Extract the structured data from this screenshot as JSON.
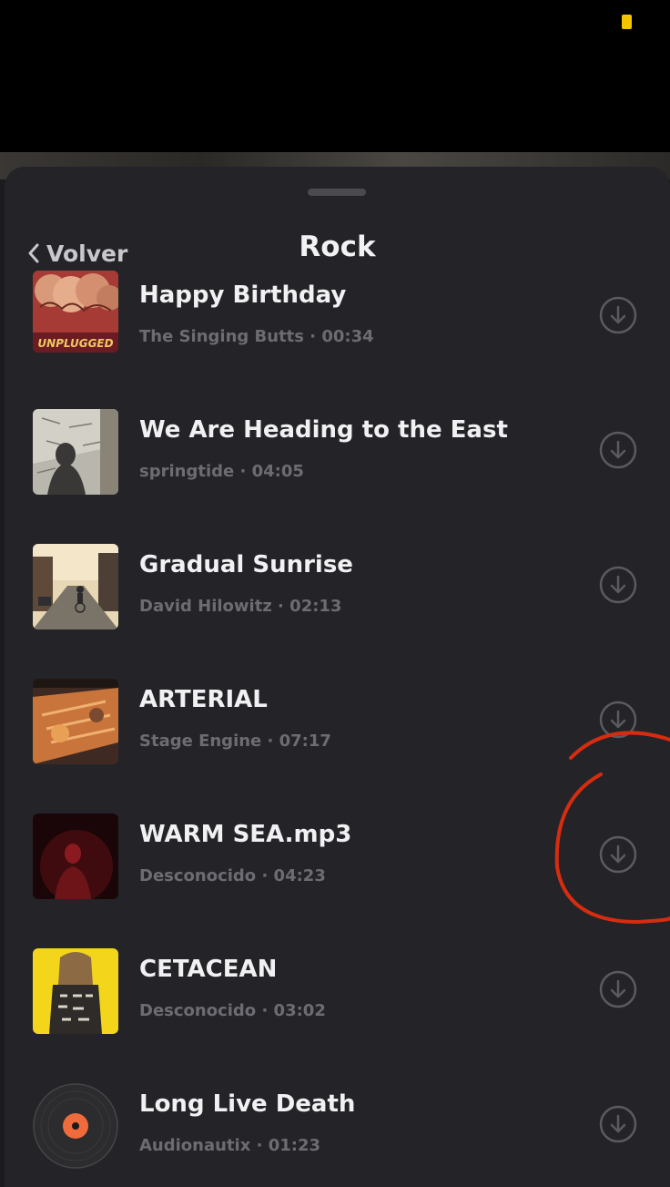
{
  "header": {
    "back_label": "Volver",
    "title": "Rock"
  },
  "songs": [
    {
      "title": "Happy Birthday",
      "subtitle": "The Singing Butts · 00:34",
      "cover": "unplugged-album",
      "cover_text": "UNPLUGGED"
    },
    {
      "title": "We Are Heading to the East",
      "subtitle": "springtide · 04:05",
      "cover": "wall-shadow-photo"
    },
    {
      "title": "Gradual Sunrise",
      "subtitle": "David Hilowitz · 02:13",
      "cover": "street-cyclist-photo"
    },
    {
      "title": "ARTERIAL",
      "subtitle": "Stage Engine · 07:17",
      "cover": "orange-abstract-art"
    },
    {
      "title": "WARM SEA.mp3",
      "subtitle": "Desconocido · 04:23",
      "cover": "red-figure-photo"
    },
    {
      "title": "CETACEAN",
      "subtitle": "Desconocido · 03:02",
      "cover": "yellow-jacket-photo"
    },
    {
      "title": "Long Live Death",
      "subtitle": "Audionautix · 01:23",
      "cover": "vinyl-record-icon"
    }
  ],
  "icons": {
    "back": "chevron-left-icon",
    "download": "download-circle-icon"
  },
  "colors": {
    "sheet": "#242428",
    "annotation": "#d62c10",
    "status_indicator": "#f5c400"
  }
}
